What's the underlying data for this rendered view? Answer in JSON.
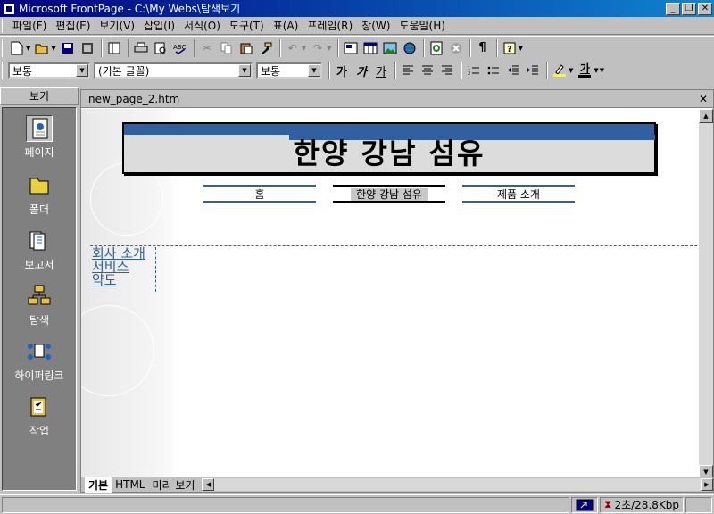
{
  "window": {
    "title": "Microsoft FrontPage - C:\\My Webs\\탐색보기"
  },
  "menu": [
    "파일(F)",
    "편집(E)",
    "보기(V)",
    "삽입(I)",
    "서식(O)",
    "도구(T)",
    "표(A)",
    "프레임(R)",
    "창(W)",
    "도움말(H)"
  ],
  "format_toolbar": {
    "style": "보통",
    "font": "(기본 글꼴)",
    "size": "보통",
    "bold": "가",
    "italic": "가",
    "underline": "가",
    "font_color": "가"
  },
  "views": {
    "header": "보기",
    "items": [
      "페이지",
      "폴더",
      "보고서",
      "탐색",
      "하이퍼링크",
      "작업"
    ],
    "active": "페이지"
  },
  "document": {
    "tab_name": "new_page_2.htm",
    "banner": "한양 강남 섬유",
    "nav_buttons": [
      "홈",
      "한양 강남 섬유",
      "제품 소개"
    ],
    "left_links": [
      "회사 소개",
      "서비스",
      "약도"
    ],
    "bottom_tabs": [
      "기본",
      "HTML",
      "미리 보기"
    ],
    "active_tab": "기본"
  },
  "status": {
    "speed": "2초/28.8Kbp"
  },
  "colors": {
    "accent": "#3060a0",
    "titlebar": "#000080"
  }
}
